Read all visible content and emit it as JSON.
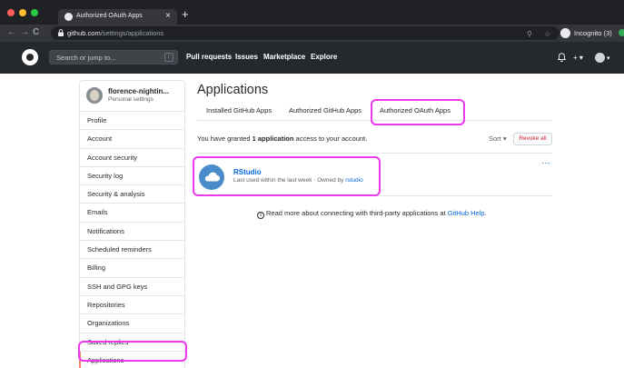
{
  "browser": {
    "tab_title": "Authorized OAuth Apps",
    "tab_close": "×",
    "new_tab": "+",
    "url_host": "github.com",
    "url_path": "/settings/applications",
    "incognito_label": "Incognito (3)",
    "nav": {
      "back": "←",
      "forward": "→",
      "reload": "C"
    },
    "icons": {
      "zoom": "⚲",
      "star": "☆"
    }
  },
  "header": {
    "search_placeholder": "Search or jump to...",
    "search_shortcut": "/",
    "nav": [
      "Pull requests",
      "Issues",
      "Marketplace",
      "Explore"
    ],
    "icons": {
      "bell": "♫",
      "plus": "+ ▾",
      "avatar_caret": "▾"
    }
  },
  "sidebar": {
    "username": "florence-nightin...",
    "subtitle": "Personal settings",
    "items": [
      "Profile",
      "Account",
      "Account security",
      "Security log",
      "Security & analysis",
      "Emails",
      "Notifications",
      "Scheduled reminders",
      "Billing",
      "SSH and GPG keys",
      "Repositories",
      "Organizations",
      "Saved replies",
      "Applications"
    ],
    "active_index": 13
  },
  "main": {
    "title": "Applications",
    "tabs": [
      "Installed GitHub Apps",
      "Authorized GitHub Apps",
      "Authorized OAuth Apps"
    ],
    "granted_prefix": "You have granted ",
    "granted_count": "1 application",
    "granted_suffix": " access to your account.",
    "sort_label": "Sort ▾",
    "revoke_all_label": "Revoke all",
    "app": {
      "name": "RStudio",
      "meta_prefix": "Last used within the last week · Owned by ",
      "owner": "rstudio",
      "more": "···"
    },
    "learn_icon": "i",
    "learn_text": "Read more about connecting with third-party applications at ",
    "learn_link": "GitHub Help",
    "learn_end": "."
  },
  "colors": {
    "highlight": "#ee38ee",
    "link": "#0366d6",
    "danger": "#cb2431",
    "header_bg": "#24292e"
  }
}
